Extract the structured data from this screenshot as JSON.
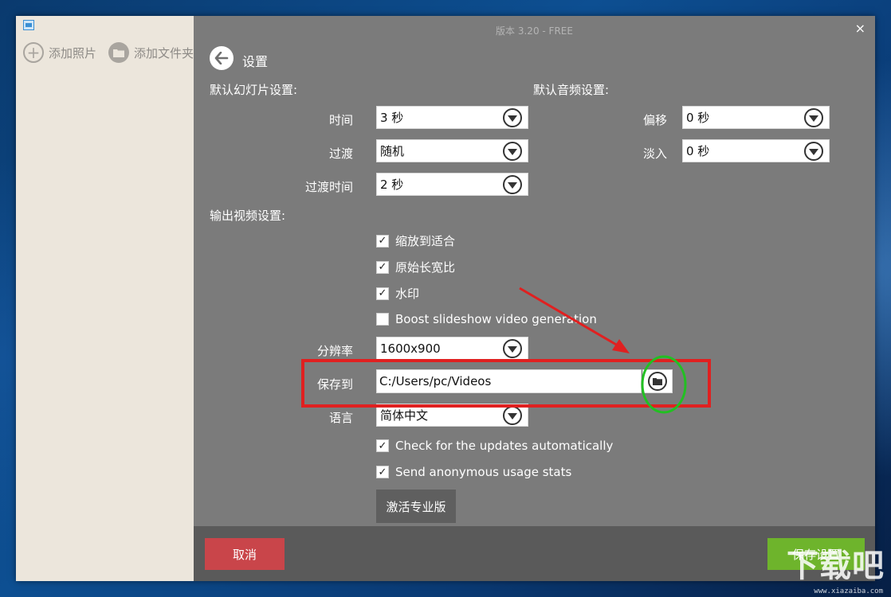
{
  "window": {
    "title": "版本 3.20 - FREE",
    "close_symbol": "×"
  },
  "left_toolbar": {
    "add_photos_label": "添加照片",
    "add_folder_label": "添加文件夹"
  },
  "header": {
    "title": "设置"
  },
  "slideshow_settings": {
    "section_label": "默认幻灯片设置:",
    "time_label": "时间",
    "time_value": "3 秒",
    "transition_label": "过渡",
    "transition_value": "随机",
    "transition_time_label": "过渡时间",
    "transition_time_value": "2 秒"
  },
  "audio_settings": {
    "section_label": "默认音频设置:",
    "offset_label": "偏移",
    "offset_value": "0 秒",
    "fade_in_label": "淡入",
    "fade_in_value": "0 秒"
  },
  "output_settings": {
    "section_label": "输出视频设置:",
    "scale_to_fit": {
      "label": "缩放到适合",
      "checked": true
    },
    "original_aspect": {
      "label": "原始长宽比",
      "checked": true
    },
    "watermark": {
      "label": "水印",
      "checked": true
    },
    "boost": {
      "label": "Boost slideshow video generation",
      "checked": false
    },
    "resolution_label": "分辨率",
    "resolution_value": "1600x900",
    "save_to_label": "保存到",
    "save_to_value": "C:/Users/pc/Videos",
    "language_label": "语言",
    "language_value": "简体中文",
    "check_updates": {
      "label": "Check for the updates automatically",
      "checked": true
    },
    "send_stats": {
      "label": "Send anonymous usage stats",
      "checked": true
    },
    "activate_label": "激活专业版"
  },
  "footer": {
    "cancel_label": "取消",
    "save_label": "保存设置"
  },
  "annotation_colors": {
    "arrow": "#e02020",
    "box": "#e02020",
    "circle": "#22c022"
  },
  "watermark": {
    "main": "下载吧",
    "sub": "www.xiazaiba.com"
  },
  "colors": {
    "panel": "#7b7b7b",
    "sidebar": "#ece6dc",
    "cancel": "#c9454a",
    "save": "#6eb42c",
    "footer": "#5a5a5a"
  }
}
